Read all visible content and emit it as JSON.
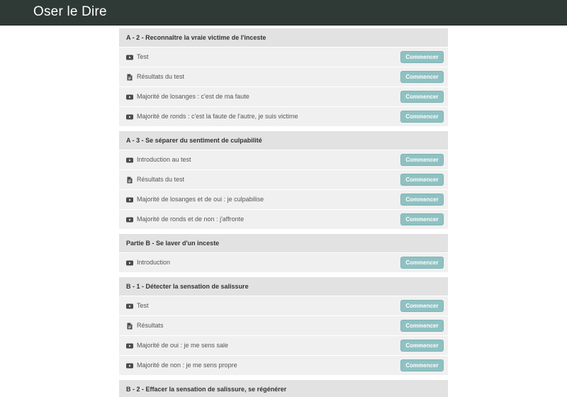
{
  "app": {
    "brand": "Oser le Dire",
    "ghost_row_label": "Introduction au test"
  },
  "colors": {
    "topbar": "#2f3a37",
    "section_header": "#e2e2e2",
    "row_bg": "#f0f0f0",
    "button": "#8fc1c2"
  },
  "sections": [
    {
      "title": "A - 2 - Reconnaître la vraie victime de l'inceste",
      "lectures": [
        {
          "icon": "video-icon",
          "title": "Test",
          "button": "Commencer"
        },
        {
          "icon": "document-icon",
          "title": "Résultats du test",
          "button": "Commencer"
        },
        {
          "icon": "video-icon",
          "title": "Majorité de losanges : c'est de ma faute",
          "button": "Commencer"
        },
        {
          "icon": "video-icon",
          "title": "Majorité de ronds : c'est la faute de l'autre, je suis victime",
          "button": "Commencer"
        }
      ]
    },
    {
      "title": "A - 3 - Se séparer du sentiment de culpabilité",
      "lectures": [
        {
          "icon": "video-icon",
          "title": "Introduction au test",
          "button": "Commencer"
        },
        {
          "icon": "document-icon",
          "title": "Résultats du test",
          "button": "Commencer"
        },
        {
          "icon": "video-icon",
          "title": "Majorité de losanges et de oui : je culpabilise",
          "button": "Commencer"
        },
        {
          "icon": "video-icon",
          "title": "Majorité de ronds et de non : j'affronte",
          "button": "Commencer"
        }
      ]
    },
    {
      "title": "Partie B - Se laver d'un inceste",
      "lectures": [
        {
          "icon": "video-icon",
          "title": "Introduction",
          "button": "Commencer"
        }
      ]
    },
    {
      "title": "B - 1 - Détecter la sensation de salissure",
      "lectures": [
        {
          "icon": "video-icon",
          "title": "Test",
          "button": "Commencer"
        },
        {
          "icon": "document-icon",
          "title": "Résultats",
          "button": "Commencer"
        },
        {
          "icon": "video-icon",
          "title": "Majorité de oui : je me sens sale",
          "button": "Commencer"
        },
        {
          "icon": "video-icon",
          "title": "Majorité de non : je me sens propre",
          "button": "Commencer"
        }
      ]
    },
    {
      "title": "B - 2 - Effacer la sensation de salissure, se régénérer",
      "lectures": []
    }
  ]
}
